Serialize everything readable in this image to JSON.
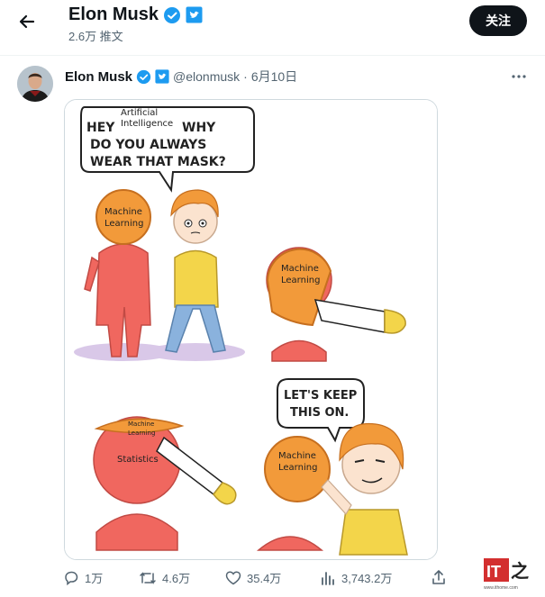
{
  "header": {
    "title": "Elon Musk",
    "count": "2.6万 推文",
    "follow_label": "关注"
  },
  "tweet": {
    "author_name": "Elon Musk",
    "handle": "@elonmusk",
    "separator": "·",
    "date": "6月10日"
  },
  "comic": {
    "bubble1_small": "Artificial",
    "bubble1_small2": "Intelligence",
    "bubble1_line1_a": "HEY",
    "bubble1_line1_b": "WHY",
    "bubble1_line2": "DO YOU ALWAYS",
    "bubble1_line3": "WEAR THAT MASK?",
    "ml_label_1a": "Machine",
    "ml_label_1b": "Learning",
    "ml_label_2a": "Machine",
    "ml_label_2b": "Learning",
    "ml_label_3a": "Machine",
    "ml_label_3b": "Learning",
    "statistics_label": "Statistics",
    "ml_label_4a": "Machine",
    "ml_label_4b": "Learning",
    "bubble2_line1": "LET'S KEEP",
    "bubble2_line2": "THIS ON."
  },
  "actions": {
    "replies": "1万",
    "retweets": "4.6万",
    "likes": "35.4万",
    "views": "3,743.2万"
  },
  "watermark": {
    "text": "IT之家",
    "url": "www.ithome.com"
  },
  "colors": {
    "verified_blue": "#1d9bf0",
    "figure_red": "#f0675f",
    "mask_orange": "#f29a3a",
    "shirt_yellow": "#f3d54a"
  }
}
